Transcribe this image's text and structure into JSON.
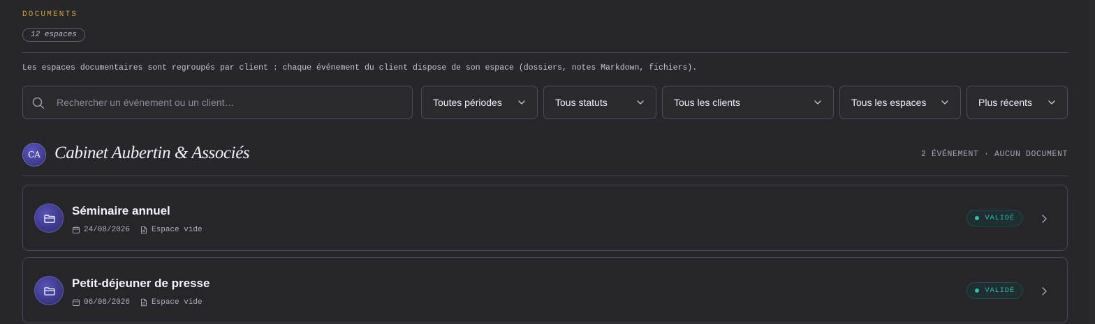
{
  "header": {
    "section_label": "DOCUMENTS",
    "count_badge": "12 espaces",
    "description": "Les espaces documentaires sont regroupés par client : chaque événement du client dispose de son espace (dossiers, notes Markdown, fichiers)."
  },
  "search": {
    "placeholder": "Rechercher un événement ou un client…",
    "value": "",
    "icon": "search-icon"
  },
  "filters": [
    {
      "label": "Toutes périodes"
    },
    {
      "label": "Tous statuts"
    },
    {
      "label": "Tous les clients"
    },
    {
      "label": "Tous les espaces"
    },
    {
      "label": "Plus récents"
    }
  ],
  "groups": [
    {
      "initials": "CA",
      "name": "Cabinet Aubertin & Associés",
      "meta": "2 ÉVÉNEMENT · AUCUN DOCUMENT",
      "events": [
        {
          "title": "Séminaire annuel",
          "date": "24/08/2026",
          "space": "Espace vide",
          "status": "VALIDÉ"
        },
        {
          "title": "Petit-déjeuner de presse",
          "date": "06/08/2026",
          "space": "Espace vide",
          "status": "VALIDÉ"
        }
      ]
    }
  ],
  "colors": {
    "background": "#27262b",
    "accent_gold": "#c9a33a",
    "status_green": "#2db8a3",
    "avatar_indigo": "#3f3c9a"
  }
}
